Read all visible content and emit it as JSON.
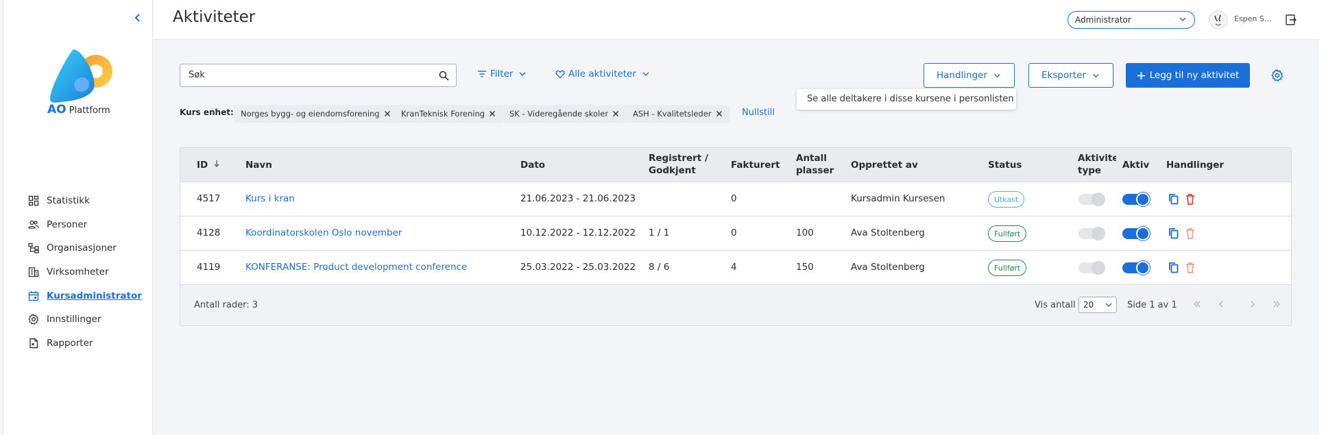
{
  "app": {
    "logo_letters": "AO",
    "logo_word": "Plattform",
    "page_title": "Aktiviteter"
  },
  "sidebar": {
    "items": [
      {
        "label": "Statistikk",
        "icon": "dashboard-icon"
      },
      {
        "label": "Personer",
        "icon": "people-icon"
      },
      {
        "label": "Organisasjoner",
        "icon": "org-chart-icon"
      },
      {
        "label": "Virksomheter",
        "icon": "building-icon"
      },
      {
        "label": "Kursadministrator",
        "icon": "calendar-icon",
        "active": true
      },
      {
        "label": "Innstillinger",
        "icon": "gear-icon"
      },
      {
        "label": "Rapporter",
        "icon": "report-icon"
      }
    ]
  },
  "header": {
    "role": "Administrator",
    "user_name": "Espen S..."
  },
  "toolbar": {
    "search_placeholder": "Søk",
    "filter_label": "Filter",
    "all_activities_label": "Alle aktiviteter",
    "actions_label": "Handlinger",
    "export_label": "Eksporter",
    "add_label": "Legg til ny aktivitet",
    "tooltip": "Se alle deltakere i disse kursene i personlisten"
  },
  "filters": {
    "label": "Kurs enhet:",
    "chips": [
      "Norges bygg- og eiendomsforening",
      "KranTeknisk Forening",
      "SK - Videregående skoler",
      "ASH - Kvalitetsleder"
    ],
    "reset_label": "Nullstill"
  },
  "table": {
    "columns": {
      "id": "ID",
      "name": "Navn",
      "date": "Dato",
      "registered_1": "Registrert /",
      "registered_2": "Godkjent",
      "invoiced": "Fakturert",
      "seats_1": "Antall",
      "seats_2": "plasser",
      "created_by": "Opprettet av",
      "status": "Status",
      "type_1": "Aktivitet",
      "type_2": "type",
      "active": "Aktiv",
      "actions": "Handlinger"
    },
    "rows": [
      {
        "id": "4517",
        "name": "Kurs i kran",
        "date": "21.06.2023 - 21.06.2023",
        "registered": "",
        "invoiced": "0",
        "seats": "",
        "created_by": "Kursadmin Kursesen",
        "status": "Utkast",
        "status_kind": "draft",
        "type_on": false,
        "active_on": true
      },
      {
        "id": "4128",
        "name": "Koordinatorskolen Oslo november",
        "date": "10.12.2022 - 12.12.2022",
        "registered": "1 / 1",
        "invoiced": "0",
        "seats": "100",
        "created_by": "Ava Stoltenberg",
        "status": "Fullført",
        "status_kind": "done",
        "type_on": false,
        "active_on": true
      },
      {
        "id": "4119",
        "name": "KONFERANSE: Product development conference",
        "date": "25.03.2022 - 25.03.2022",
        "registered": "8 / 6",
        "invoiced": "4",
        "seats": "150",
        "created_by": "Ava Stoltenberg",
        "status": "Fullført",
        "status_kind": "done",
        "type_on": false,
        "active_on": true
      }
    ],
    "footer": {
      "row_count": "Antall rader: 3",
      "page_size_label": "Vis antall",
      "page_size": "20",
      "page_info": "Side 1 av 1"
    }
  },
  "colors": {
    "accent": "#1a6fd9",
    "success": "#1f8c4a",
    "draft": "#5aa9e6",
    "danger": "#e0402a"
  }
}
